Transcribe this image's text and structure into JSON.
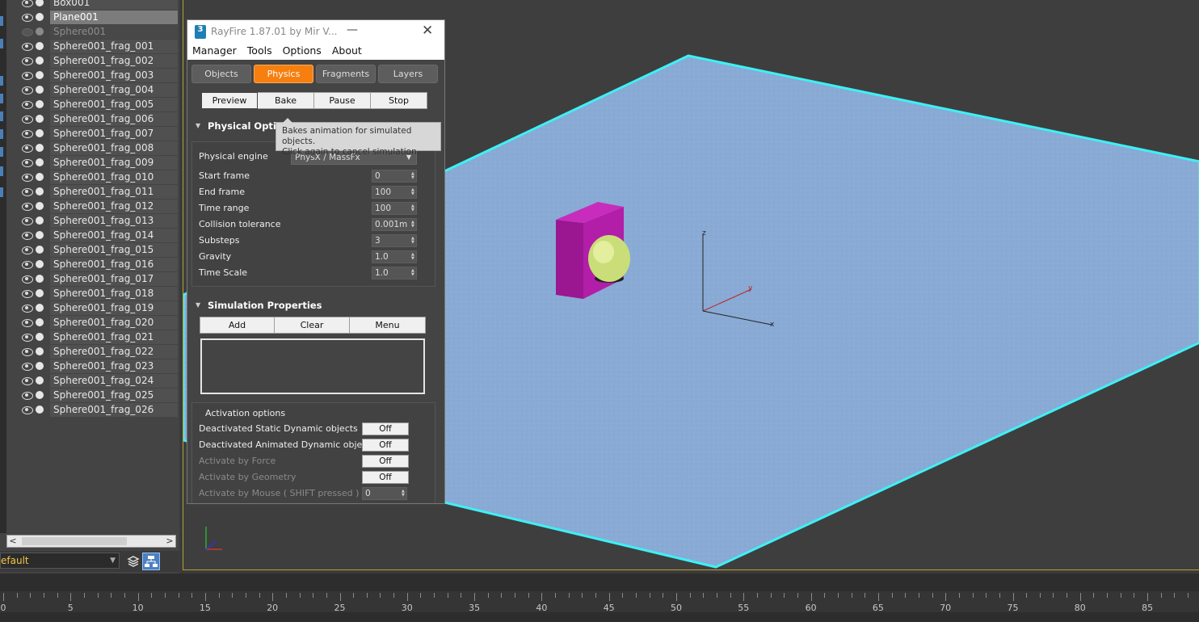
{
  "explorer": {
    "objects": [
      {
        "name": "Box001",
        "state": "normal"
      },
      {
        "name": "Plane001",
        "state": "selected"
      },
      {
        "name": "Sphere001",
        "state": "hidden"
      },
      {
        "name": "Sphere001_frag_001",
        "state": "normal"
      },
      {
        "name": "Sphere001_frag_002",
        "state": "normal"
      },
      {
        "name": "Sphere001_frag_003",
        "state": "normal"
      },
      {
        "name": "Sphere001_frag_004",
        "state": "normal"
      },
      {
        "name": "Sphere001_frag_005",
        "state": "normal"
      },
      {
        "name": "Sphere001_frag_006",
        "state": "normal"
      },
      {
        "name": "Sphere001_frag_007",
        "state": "normal"
      },
      {
        "name": "Sphere001_frag_008",
        "state": "normal"
      },
      {
        "name": "Sphere001_frag_009",
        "state": "normal"
      },
      {
        "name": "Sphere001_frag_010",
        "state": "normal"
      },
      {
        "name": "Sphere001_frag_011",
        "state": "normal"
      },
      {
        "name": "Sphere001_frag_012",
        "state": "normal"
      },
      {
        "name": "Sphere001_frag_013",
        "state": "normal"
      },
      {
        "name": "Sphere001_frag_014",
        "state": "normal"
      },
      {
        "name": "Sphere001_frag_015",
        "state": "normal"
      },
      {
        "name": "Sphere001_frag_016",
        "state": "normal"
      },
      {
        "name": "Sphere001_frag_017",
        "state": "normal"
      },
      {
        "name": "Sphere001_frag_018",
        "state": "normal"
      },
      {
        "name": "Sphere001_frag_019",
        "state": "normal"
      },
      {
        "name": "Sphere001_frag_020",
        "state": "normal"
      },
      {
        "name": "Sphere001_frag_021",
        "state": "normal"
      },
      {
        "name": "Sphere001_frag_022",
        "state": "normal"
      },
      {
        "name": "Sphere001_frag_023",
        "state": "normal"
      },
      {
        "name": "Sphere001_frag_024",
        "state": "normal"
      },
      {
        "name": "Sphere001_frag_025",
        "state": "normal"
      },
      {
        "name": "Sphere001_frag_026",
        "state": "normal"
      }
    ],
    "layer_name": "efault"
  },
  "rayfire": {
    "title": "RayFire 1.87.01   by Mir V...",
    "logo_text": "3",
    "minimize": "—",
    "close": "✕",
    "menu": [
      "Manager",
      "Tools",
      "Options",
      "About"
    ],
    "tabs": [
      {
        "label": "Objects",
        "active": false
      },
      {
        "label": "Physics",
        "active": true
      },
      {
        "label": "Fragments",
        "active": false
      },
      {
        "label": "Layers",
        "active": false
      }
    ],
    "sim_buttons": [
      "Preview",
      "Bake",
      "Pause",
      "Stop"
    ],
    "physical_options": {
      "header": "Physical Option",
      "engine_label": "Physical engine",
      "engine_value": "PhysX / MassFx",
      "params": [
        {
          "label": "Start frame",
          "value": "0"
        },
        {
          "label": "End frame",
          "value": "100"
        },
        {
          "label": "Time range",
          "value": "100"
        },
        {
          "label": "Collision tolerance",
          "value": "0.001m"
        },
        {
          "label": "Substeps",
          "value": "3"
        },
        {
          "label": "Gravity",
          "value": "1.0"
        },
        {
          "label": "Time Scale",
          "value": "1.0"
        }
      ]
    },
    "simulation_properties": {
      "header": "Simulation Properties",
      "buttons": [
        "Add",
        "Clear",
        "Menu"
      ]
    },
    "activation": {
      "header": "Activation options",
      "rows": [
        {
          "label": "Deactivated Static Dynamic objects",
          "value": "Off",
          "kind": "button",
          "enabled": true
        },
        {
          "label": "Deactivated Animated Dynamic objects",
          "value": "Off",
          "kind": "button",
          "enabled": true
        },
        {
          "label": "Activate by Force",
          "value": "Off",
          "kind": "button",
          "enabled": false
        },
        {
          "label": "Activate by Geometry",
          "value": "Off",
          "kind": "button",
          "enabled": false
        },
        {
          "label": "Activate by Mouse ( SHIFT pressed )",
          "value": "0",
          "kind": "spinner",
          "enabled": false
        }
      ]
    },
    "tooltip": {
      "line1": "Bakes animation for simulated objects.",
      "line2": "Click again to cancel simulation."
    }
  },
  "viewport": {
    "axis_labels": {
      "x": "x",
      "y": "y",
      "z": "z"
    }
  },
  "timeline": {
    "labels": [
      "0",
      "5",
      "10",
      "15",
      "20",
      "25",
      "30",
      "35",
      "40",
      "45",
      "50",
      "55",
      "60",
      "65",
      "70",
      "75",
      "80",
      "85"
    ]
  },
  "colors": {
    "accent_tab": "#f77f0f",
    "plane": "#87a9d3",
    "plane_edge": "#3ef0f5",
    "box": "#b21ea8",
    "sphere": "#c9de78"
  }
}
